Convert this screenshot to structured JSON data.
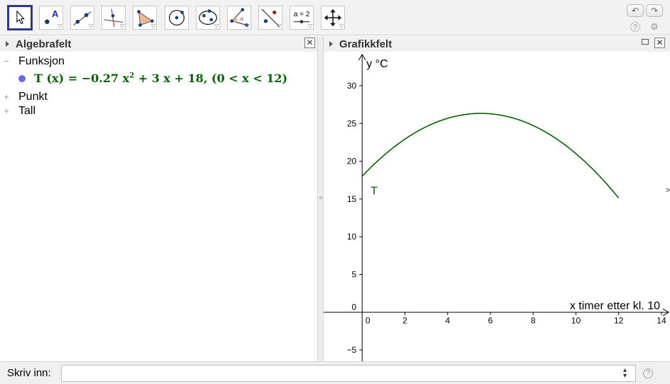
{
  "toolbar": {
    "tools": [
      {
        "name": "move-tool",
        "icon": "cursor-arrow-icon"
      },
      {
        "name": "point-tool",
        "icon": "point-icon",
        "letter": "A"
      },
      {
        "name": "line-tool",
        "icon": "line-through-two-points-icon"
      },
      {
        "name": "perpendicular-line-tool",
        "icon": "perpendicular-line-icon"
      },
      {
        "name": "polygon-tool",
        "icon": "polygon-icon"
      },
      {
        "name": "circle-tool",
        "icon": "circle-center-point-icon"
      },
      {
        "name": "ellipse-tool",
        "icon": "ellipse-icon"
      },
      {
        "name": "angle-tool",
        "icon": "angle-icon"
      },
      {
        "name": "reflect-tool",
        "icon": "reflect-about-line-icon"
      },
      {
        "name": "slider-tool",
        "icon": "slider-icon",
        "label": "a = 2"
      },
      {
        "name": "move-graphics-view-tool",
        "icon": "move-view-arrows-icon"
      }
    ],
    "undo_icon": "undo-icon",
    "redo_icon": "redo-icon",
    "help_icon": "help-icon",
    "settings_icon": "gear-icon"
  },
  "algebra": {
    "title": "Algebrafelt",
    "groups": [
      {
        "label": "Funksjon",
        "toggle": "−",
        "items": [
          {
            "formula_prefix": "T (x)  =  −0.27 x",
            "exponent": "2",
            "formula_suffix": " + 3 x + 18,     (0 < x < 12)"
          }
        ]
      },
      {
        "label": "Punkt",
        "toggle": "+"
      },
      {
        "label": "Tall",
        "toggle": "+"
      }
    ]
  },
  "graphics": {
    "title": "Grafikkfelt",
    "y_label": "y °C",
    "x_label": "x timer etter kl. 10",
    "curve_label": "T",
    "curve_color": "#006400"
  },
  "chart_data": {
    "type": "line",
    "function": "T(x) = -0.27x^2 + 3x + 18",
    "coefficients": {
      "a": -0.27,
      "b": 3,
      "c": 18
    },
    "domain": [
      0,
      12
    ],
    "x": [
      0,
      1,
      2,
      3,
      4,
      5,
      6,
      7,
      8,
      9,
      10,
      11,
      12
    ],
    "y": [
      18,
      20.73,
      22.92,
      24.57,
      25.68,
      26.25,
      26.28,
      25.77,
      24.72,
      23.13,
      21,
      18.33,
      15.12
    ],
    "xlim": [
      -1.8,
      14.4
    ],
    "ylim": [
      -6.5,
      34.5
    ],
    "x_ticks": [
      0,
      2,
      4,
      6,
      8,
      10,
      12,
      14
    ],
    "x_tick_labels": [
      "0",
      "2",
      "4",
      "6",
      "8",
      "10",
      "12",
      "14"
    ],
    "y_ticks": [
      -5,
      0,
      5,
      10,
      15,
      20,
      25,
      30
    ],
    "y_tick_labels": [
      "−5",
      "0",
      "5",
      "10",
      "15",
      "20",
      "25",
      "30"
    ],
    "xlabel": "x timer etter kl. 10",
    "ylabel": "y °C",
    "grid": false,
    "series_name": "T"
  },
  "input_bar": {
    "label": "Skriv inn:",
    "value": "",
    "placeholder": ""
  },
  "colors": {
    "curve": "#006400",
    "selected_tool_border": "#2d3a8c",
    "function_dot": "#6666ee"
  }
}
